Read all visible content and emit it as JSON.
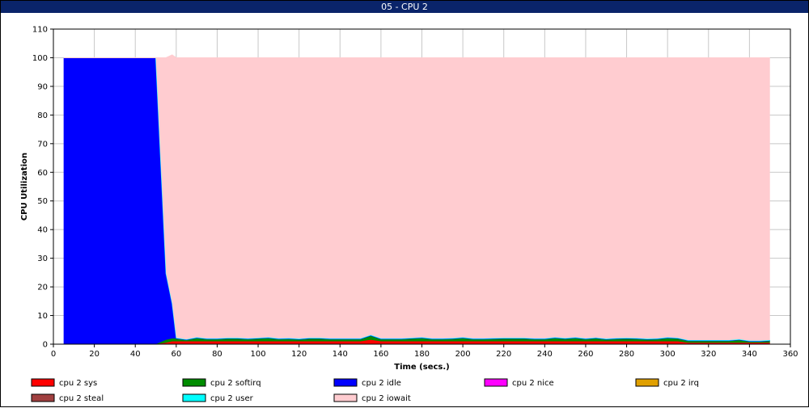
{
  "window": {
    "title": "05 - CPU 2"
  },
  "chart_data": {
    "type": "area",
    "stacked": true,
    "title": "",
    "xlabel": "Time (secs.)",
    "ylabel": "CPU Utilization",
    "xlim": [
      0,
      360
    ],
    "ylim": [
      0,
      110
    ],
    "xticks": [
      0,
      20,
      40,
      60,
      80,
      100,
      120,
      140,
      160,
      180,
      200,
      220,
      240,
      260,
      280,
      300,
      320,
      340,
      360
    ],
    "yticks": [
      0,
      10,
      20,
      30,
      40,
      50,
      60,
      70,
      80,
      90,
      100,
      110
    ],
    "grid": true,
    "legend_position": "bottom",
    "x": [
      5,
      50,
      55,
      58,
      60,
      65,
      70,
      75,
      80,
      85,
      90,
      95,
      100,
      105,
      110,
      115,
      120,
      125,
      130,
      135,
      140,
      145,
      150,
      155,
      160,
      165,
      170,
      175,
      180,
      185,
      190,
      195,
      200,
      205,
      210,
      215,
      220,
      225,
      230,
      235,
      240,
      245,
      250,
      255,
      260,
      265,
      270,
      275,
      280,
      285,
      290,
      295,
      300,
      305,
      310,
      315,
      320,
      325,
      330,
      335,
      340,
      345,
      350
    ],
    "series": [
      {
        "name": "cpu 2 sys",
        "color": "#ff0000",
        "values": [
          0,
          0,
          0.5,
          1,
          1,
          1,
          1,
          1,
          1,
          1,
          1,
          1,
          1,
          1,
          1,
          1,
          1,
          1,
          1,
          1,
          1,
          1,
          1,
          1.5,
          1,
          1,
          1,
          1,
          1,
          1,
          1,
          1,
          1,
          1,
          1,
          1,
          1,
          1,
          1,
          1,
          1,
          1,
          1,
          1,
          1,
          1,
          1,
          1,
          1,
          1,
          1,
          1,
          1,
          1,
          0.5,
          0.5,
          0.5,
          0.5,
          0.5,
          0.5,
          0.5,
          0.5,
          0.5
        ]
      },
      {
        "name": "cpu 2 softirq",
        "color": "#008c00",
        "values": [
          0,
          0,
          1,
          1,
          1,
          0.5,
          1.2,
          0.8,
          0.8,
          1,
          1,
          0.8,
          1,
          1.2,
          0.8,
          0.9,
          0.7,
          1,
          1,
          0.8,
          0.8,
          0.8,
          0.8,
          1.5,
          0.8,
          0.8,
          0.8,
          1,
          1.2,
          0.8,
          0.8,
          0.9,
          1.2,
          0.8,
          0.8,
          0.9,
          1,
          1,
          1,
          0.8,
          0.8,
          1.2,
          0.9,
          1.2,
          0.8,
          1.1,
          0.7,
          0.9,
          1,
          0.9,
          0.7,
          0.8,
          1.2,
          1,
          0.7,
          0.7,
          0.7,
          0.7,
          0.7,
          1,
          0.5,
          0.5,
          0.7
        ]
      },
      {
        "name": "cpu 2 idle",
        "color": "#0000ff",
        "values": [
          100,
          100,
          23,
          12,
          0,
          0,
          0,
          0,
          0,
          0,
          0,
          0,
          0,
          0,
          0,
          0,
          0,
          0,
          0,
          0,
          0,
          0,
          0,
          0,
          0,
          0,
          0,
          0,
          0,
          0,
          0,
          0,
          0,
          0,
          0,
          0,
          0,
          0,
          0,
          0,
          0,
          0,
          0,
          0,
          0,
          0,
          0,
          0,
          0,
          0,
          0,
          0,
          0,
          0,
          0,
          0,
          0,
          0,
          0,
          0,
          0,
          0,
          0
        ]
      },
      {
        "name": "cpu 2 nice",
        "color": "#ff00ff",
        "values": []
      },
      {
        "name": "cpu 2 irq",
        "color": "#e0a000",
        "values": []
      },
      {
        "name": "cpu 2 steal",
        "color": "#a04040",
        "values": []
      },
      {
        "name": "cpu 2 user",
        "color": "#00ffff",
        "values": [
          0,
          0,
          0.2,
          0.2,
          0.2,
          0.2,
          0.2,
          0.2,
          0.2,
          0.2,
          0.2,
          0.2,
          0.2,
          0.2,
          0.2,
          0.2,
          0.2,
          0.2,
          0.2,
          0.2,
          0.2,
          0.2,
          0.2,
          0.2,
          0.2,
          0.2,
          0.2,
          0.2,
          0.2,
          0.2,
          0.2,
          0.2,
          0.2,
          0.2,
          0.2,
          0.2,
          0.2,
          0.2,
          0.2,
          0.2,
          0.2,
          0.2,
          0.2,
          0.2,
          0.2,
          0.2,
          0.2,
          0.2,
          0.2,
          0.2,
          0.2,
          0.2,
          0.2,
          0.2,
          0.2,
          0.2,
          0.2,
          0.2,
          0.2,
          0.2,
          0.2,
          0.2,
          0.2
        ]
      },
      {
        "name": "cpu 2 iowait",
        "color": "#ffccd0",
        "values": [
          0,
          0,
          75.3,
          86.8,
          97.8,
          98.3,
          97.6,
          98,
          98,
          97.8,
          97.8,
          98,
          97.8,
          97.6,
          98,
          97.9,
          98.1,
          97.8,
          97.8,
          98,
          98,
          98,
          98,
          96.8,
          98,
          98,
          98,
          97.8,
          97.6,
          98,
          98,
          97.9,
          97.6,
          98,
          98,
          97.9,
          97.8,
          97.8,
          97.8,
          98,
          98,
          97.6,
          97.9,
          97.6,
          98,
          97.7,
          98.1,
          97.9,
          97.8,
          97.9,
          98.1,
          98,
          97.6,
          97.8,
          98.6,
          98.6,
          98.6,
          98.6,
          98.6,
          98.3,
          98.8,
          98.8,
          98.6
        ]
      }
    ]
  }
}
